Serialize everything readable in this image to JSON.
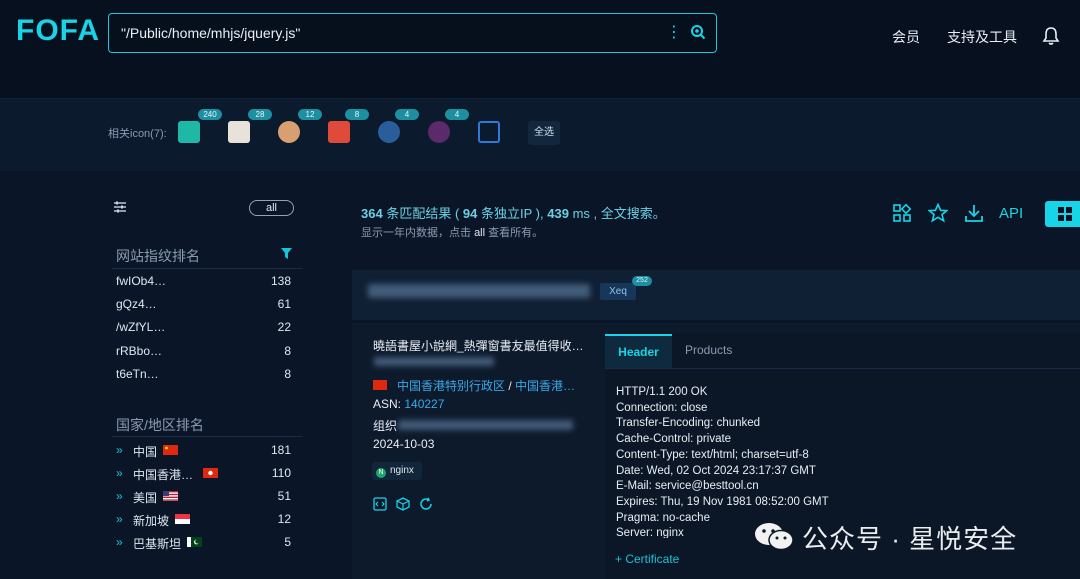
{
  "brand": {
    "logo": "FOFA"
  },
  "search": {
    "query": "\"/Public/home/mhjs/jquery.js\""
  },
  "topnav": {
    "member": "会员",
    "support": "支持及工具"
  },
  "related_icons": {
    "label": "相关icon(7):",
    "items": [
      {
        "name": "icon-1",
        "count": "240",
        "color": "#1fb7a6"
      },
      {
        "name": "icon-2",
        "count": "28",
        "color": "#e8e2da"
      },
      {
        "name": "icon-3",
        "count": "12",
        "color": "#d8a070"
      },
      {
        "name": "icon-4",
        "count": "8",
        "color": "#e04a3a"
      },
      {
        "name": "icon-5",
        "count": "4",
        "color": "#2a5e9a"
      },
      {
        "name": "icon-6",
        "count": "4",
        "color": "#5a2a6a"
      },
      {
        "name": "icon-7",
        "count": "",
        "color": "#2f7ad8"
      }
    ],
    "select_all": "全选"
  },
  "sidebar": {
    "all_label": "all",
    "fingerprint_title": "网站指纹排名",
    "fingerprints": [
      {
        "name": "fwIOb4…",
        "count": "138"
      },
      {
        "name": "gQz4…",
        "count": "61"
      },
      {
        "name": "/wZfYL…",
        "count": "22"
      },
      {
        "name": "rRBbo…",
        "count": "8"
      },
      {
        "name": "t6eTn…",
        "count": "8"
      }
    ],
    "country_title": "国家/地区排名",
    "countries": [
      {
        "name": "中国",
        "count": "181",
        "flag": "cn"
      },
      {
        "name": "中国香港…",
        "count": "110",
        "flag": "hk"
      },
      {
        "name": "美国",
        "count": "51",
        "flag": "us"
      },
      {
        "name": "新加坡",
        "count": "12",
        "flag": "sg"
      },
      {
        "name": "巴基斯坦",
        "count": "5",
        "flag": "pk"
      }
    ]
  },
  "results": {
    "count": "364",
    "count_text": "条匹配结果 (",
    "ip_count": "94",
    "ip_text": "条独立IP ),",
    "time": "439",
    "time_text": "ms ,",
    "fulltext": "全文搜索。",
    "sub_prefix": "显示一年内数据，点击",
    "sub_all": "all",
    "sub_suffix": "查看所有。",
    "api_label": "API"
  },
  "host": {
    "tag": "Xeq",
    "badge": "252"
  },
  "result_card": {
    "title": "曉語書屋小說網_熱彈窗書友最值得收…",
    "location_region": "中国香港特别行政区",
    "location_sep": "/",
    "location_city": "中国香港…",
    "asn_label": "ASN:",
    "asn_value": "140227",
    "org_label": "组织",
    "date": "2024-10-03",
    "server_tag": "nginx"
  },
  "header_panel": {
    "tabs": [
      "Header",
      "Products"
    ],
    "lines": [
      "HTTP/1.1 200 OK",
      "Connection: close",
      "Transfer-Encoding: chunked",
      "Cache-Control: private",
      "Content-Type: text/html; charset=utf-8",
      "Date: Wed, 02 Oct 2024 23:17:37 GMT",
      "E-Mail: service@besttool.cn",
      "Expires: Thu, 19 Nov 1981 08:52:00 GMT",
      "Pragma: no-cache",
      "Server: nginx"
    ],
    "certificate": "+ Certificate"
  },
  "watermark": {
    "text": "公众号 · 星悦安全"
  }
}
